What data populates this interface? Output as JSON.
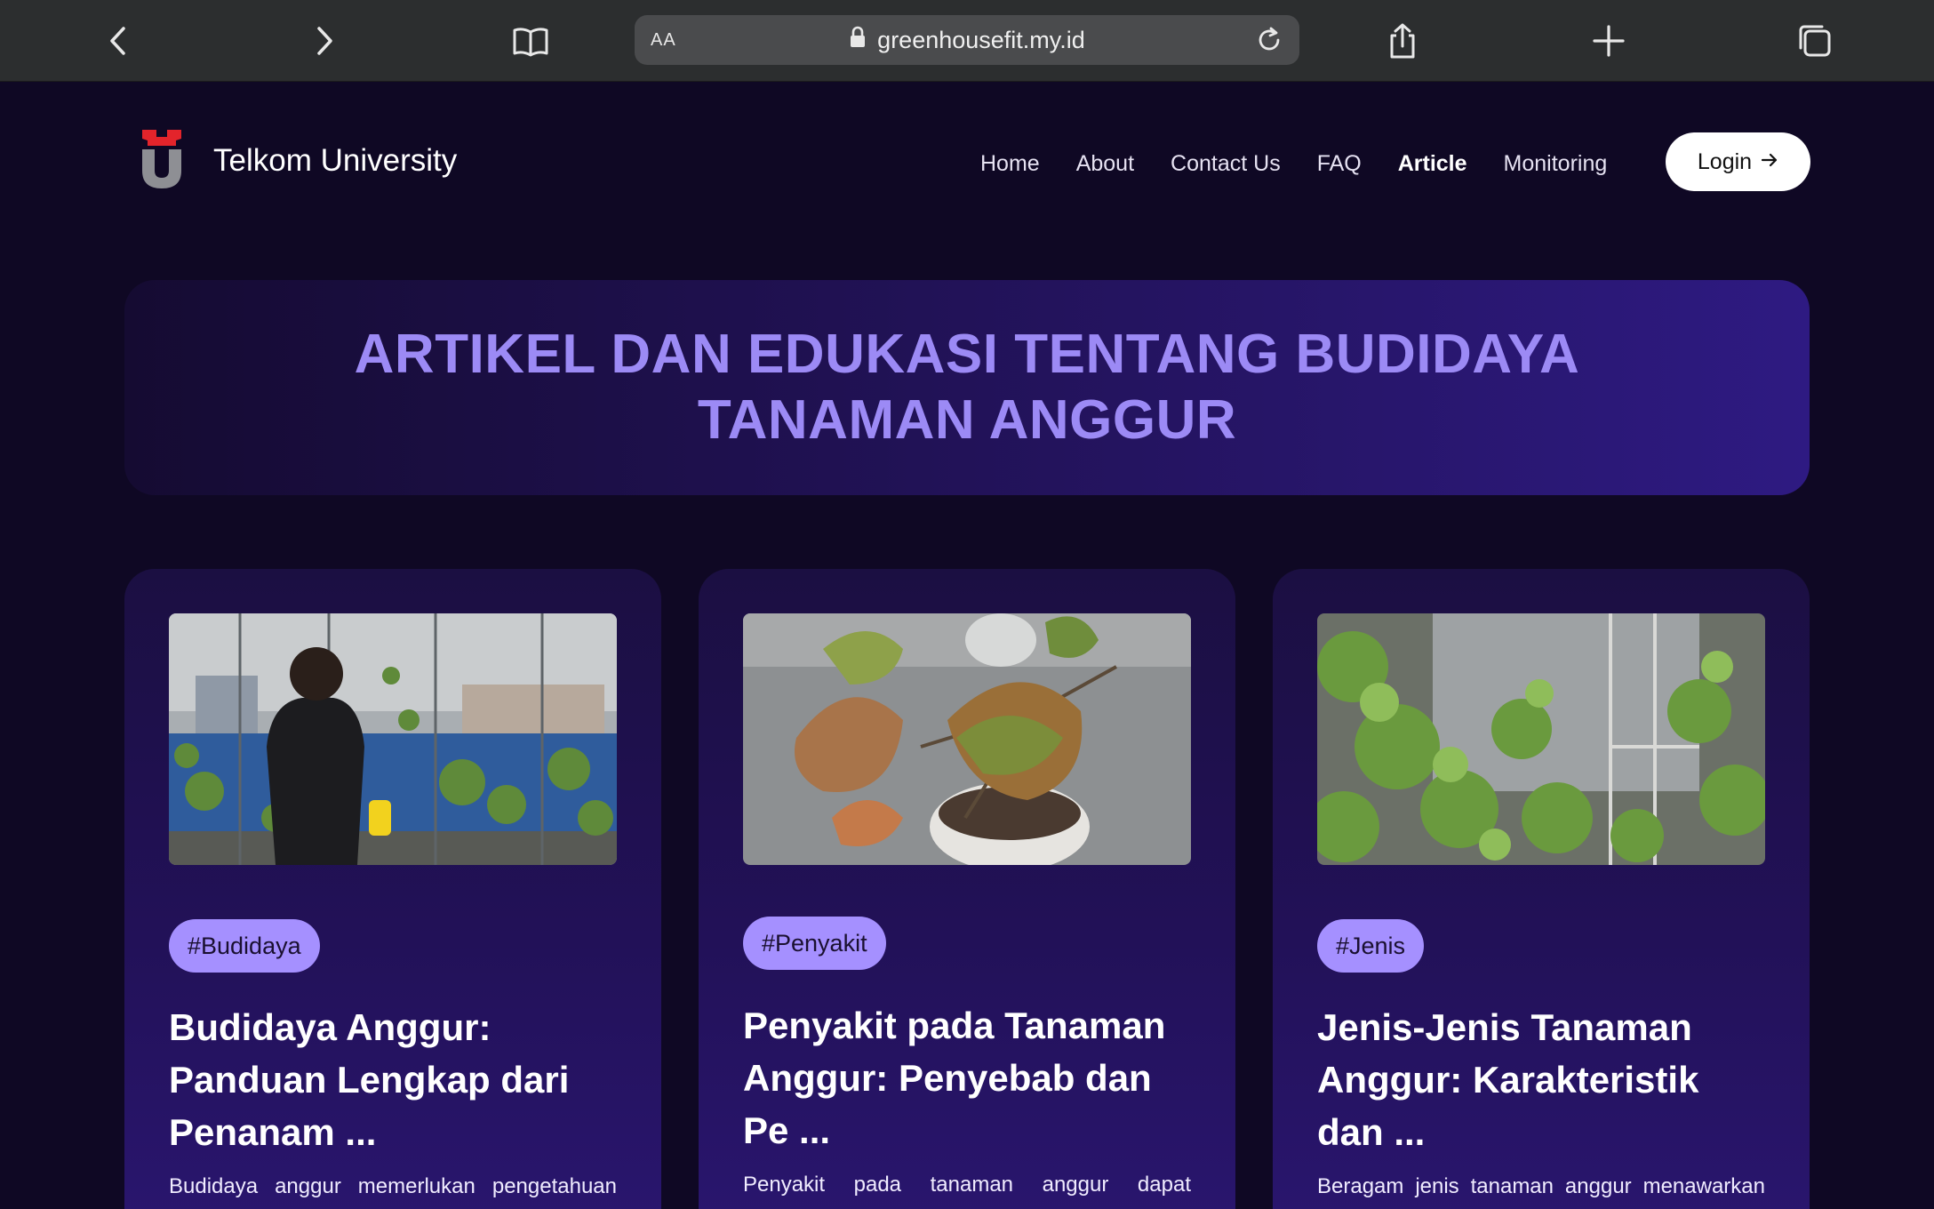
{
  "browser": {
    "url_aa": "AA",
    "url": "greenhousefit.my.id",
    "icons": [
      "back-icon",
      "forward-icon",
      "bookmarks-icon",
      "lock-icon",
      "reload-icon",
      "share-icon",
      "new-tab-icon",
      "tabs-icon"
    ]
  },
  "site": {
    "brand": "Telkom University",
    "nav": [
      "Home",
      "About",
      "Contact Us",
      "FAQ",
      "Article",
      "Monitoring"
    ],
    "active_nav": "Article",
    "login_label": "Login",
    "colors": {
      "background": "#0f0824",
      "hero_text": "#9c8af5",
      "tag_bg": "#a590ff",
      "logo_red": "#e3242b",
      "logo_grey": "#8e8f94"
    }
  },
  "hero": {
    "title": "ARTIKEL DAN EDUKASI TENTANG BUDIDAYA TANAMAN ANGGUR"
  },
  "articles": [
    {
      "tag": "#Budidaya",
      "title": "Budidaya Anggur: Panduan Lengkap dari Penanam ...",
      "excerpt": "Budidaya anggur memerlukan pengetahuan"
    },
    {
      "tag": "#Penyakit",
      "title": "Penyakit pada Tanaman Anggur: Penyebab dan Pe ...",
      "excerpt": "Penyakit pada tanaman anggur dapat"
    },
    {
      "tag": "#Jenis",
      "title": "Jenis-Jenis Tanaman Anggur: Karakteristik dan ...",
      "excerpt": "Beragam jenis tanaman anggur menawarkan"
    }
  ]
}
